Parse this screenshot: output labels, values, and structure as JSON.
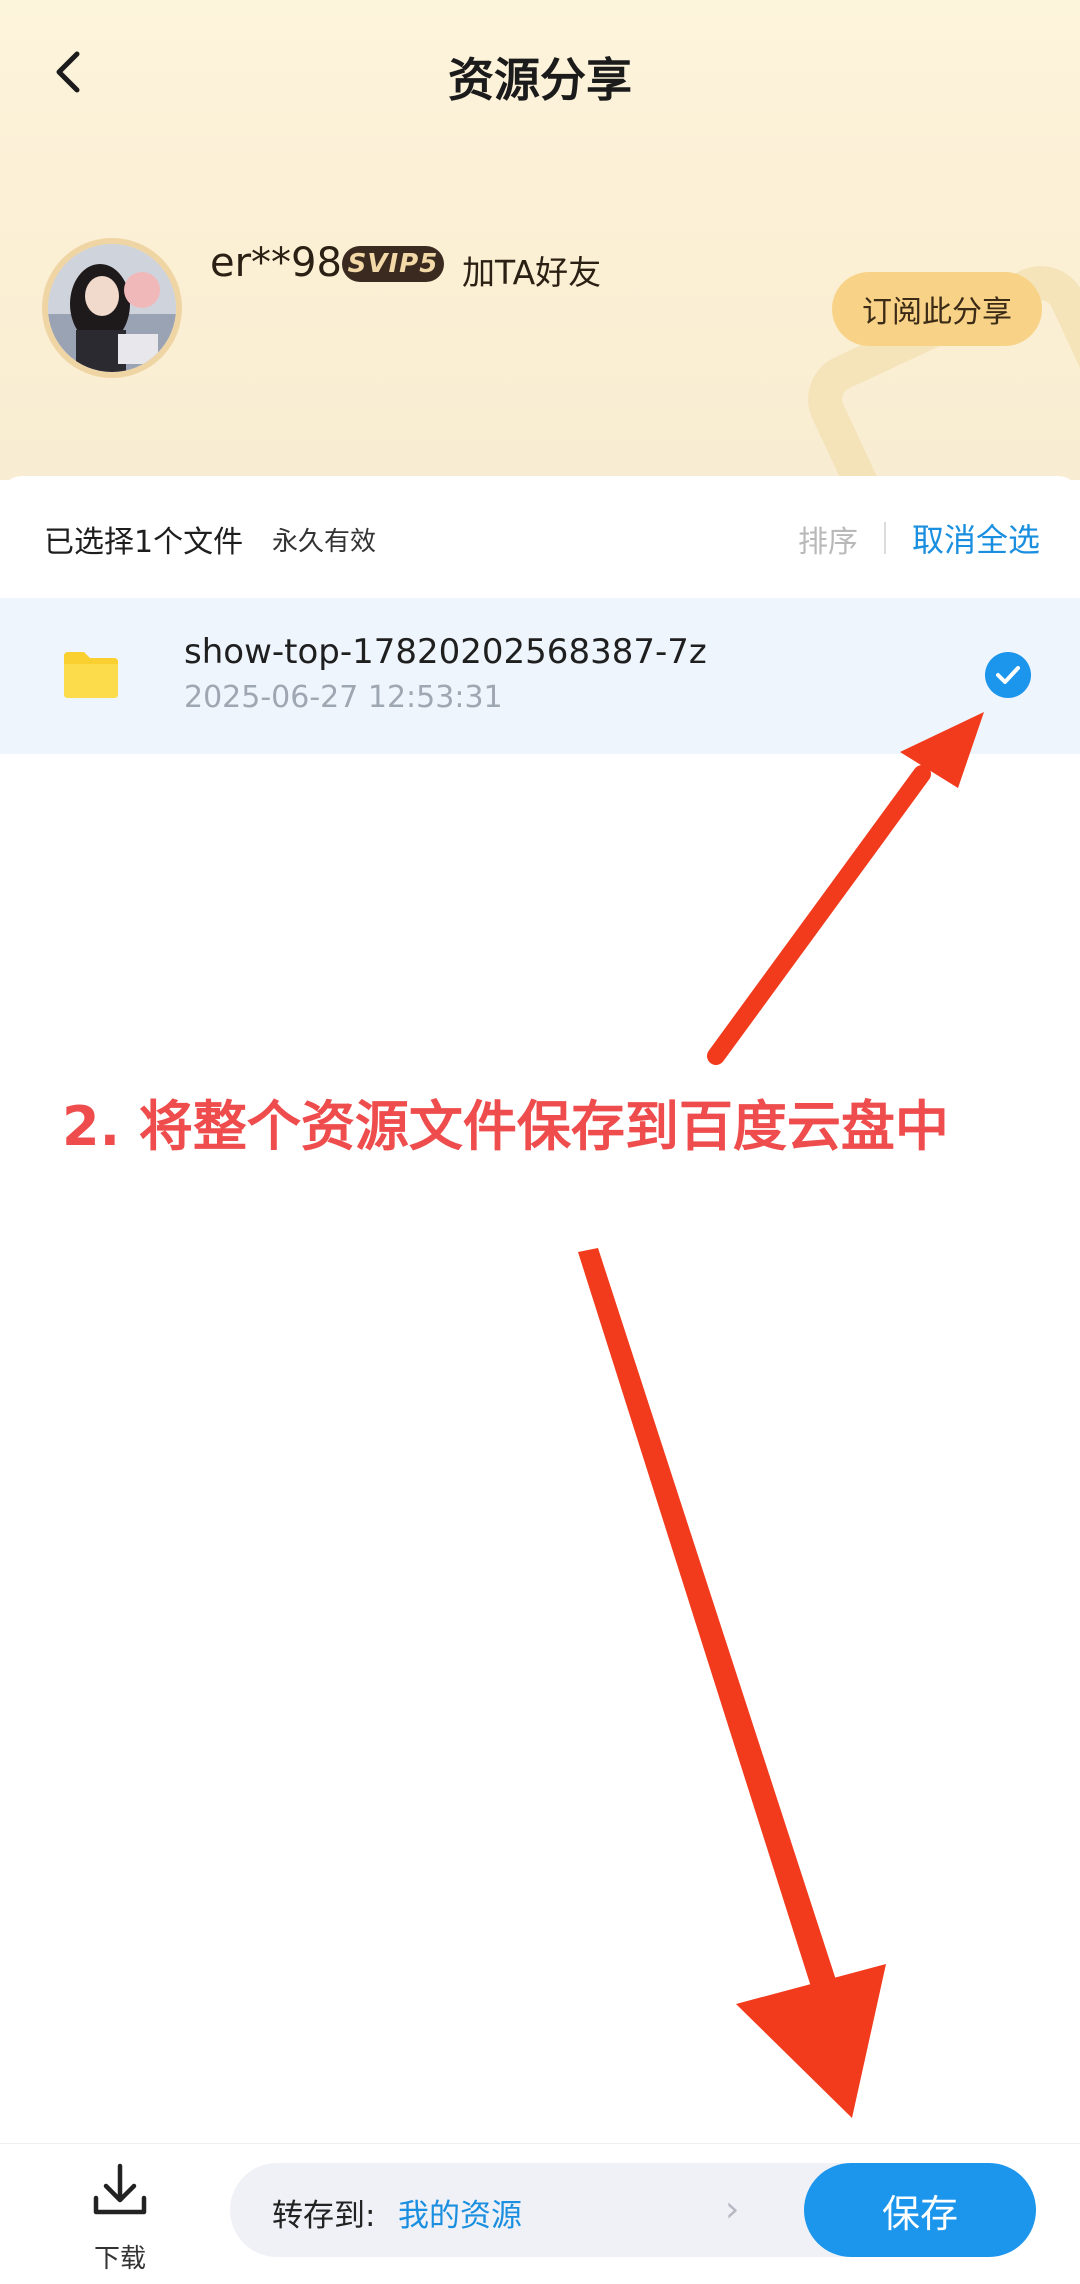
{
  "header": {
    "title": "资源分享",
    "back_icon": "chevron-left-icon"
  },
  "sharer": {
    "username": "er**98",
    "vip_badge": "SVIP5",
    "add_friend": "加TA好友",
    "subscribe_label": "订阅此分享"
  },
  "selection": {
    "info": "已选择1个文件",
    "validity": "永久有效",
    "sort_label": "排序",
    "cancel_all_label": "取消全选"
  },
  "files": [
    {
      "name": "show-top-17820202568387-7z",
      "date": "2025-06-27   12:53:31",
      "icon": "folder-icon",
      "selected": true
    }
  ],
  "annotation": {
    "text": "2. 将整个资源文件保存到百度云盘中",
    "color": "#ef4d4d",
    "arrow_color": "#f23a1c"
  },
  "bottom": {
    "download_label": "下载",
    "save_to_label": "转存到:",
    "save_to_target": "我的资源",
    "save_label": "保存"
  },
  "colors": {
    "accent": "#1c95ec",
    "header_bg": "#fdf4dc",
    "subscribe_bg": "#f8d387",
    "selected_row_bg": "#eef5fc"
  }
}
